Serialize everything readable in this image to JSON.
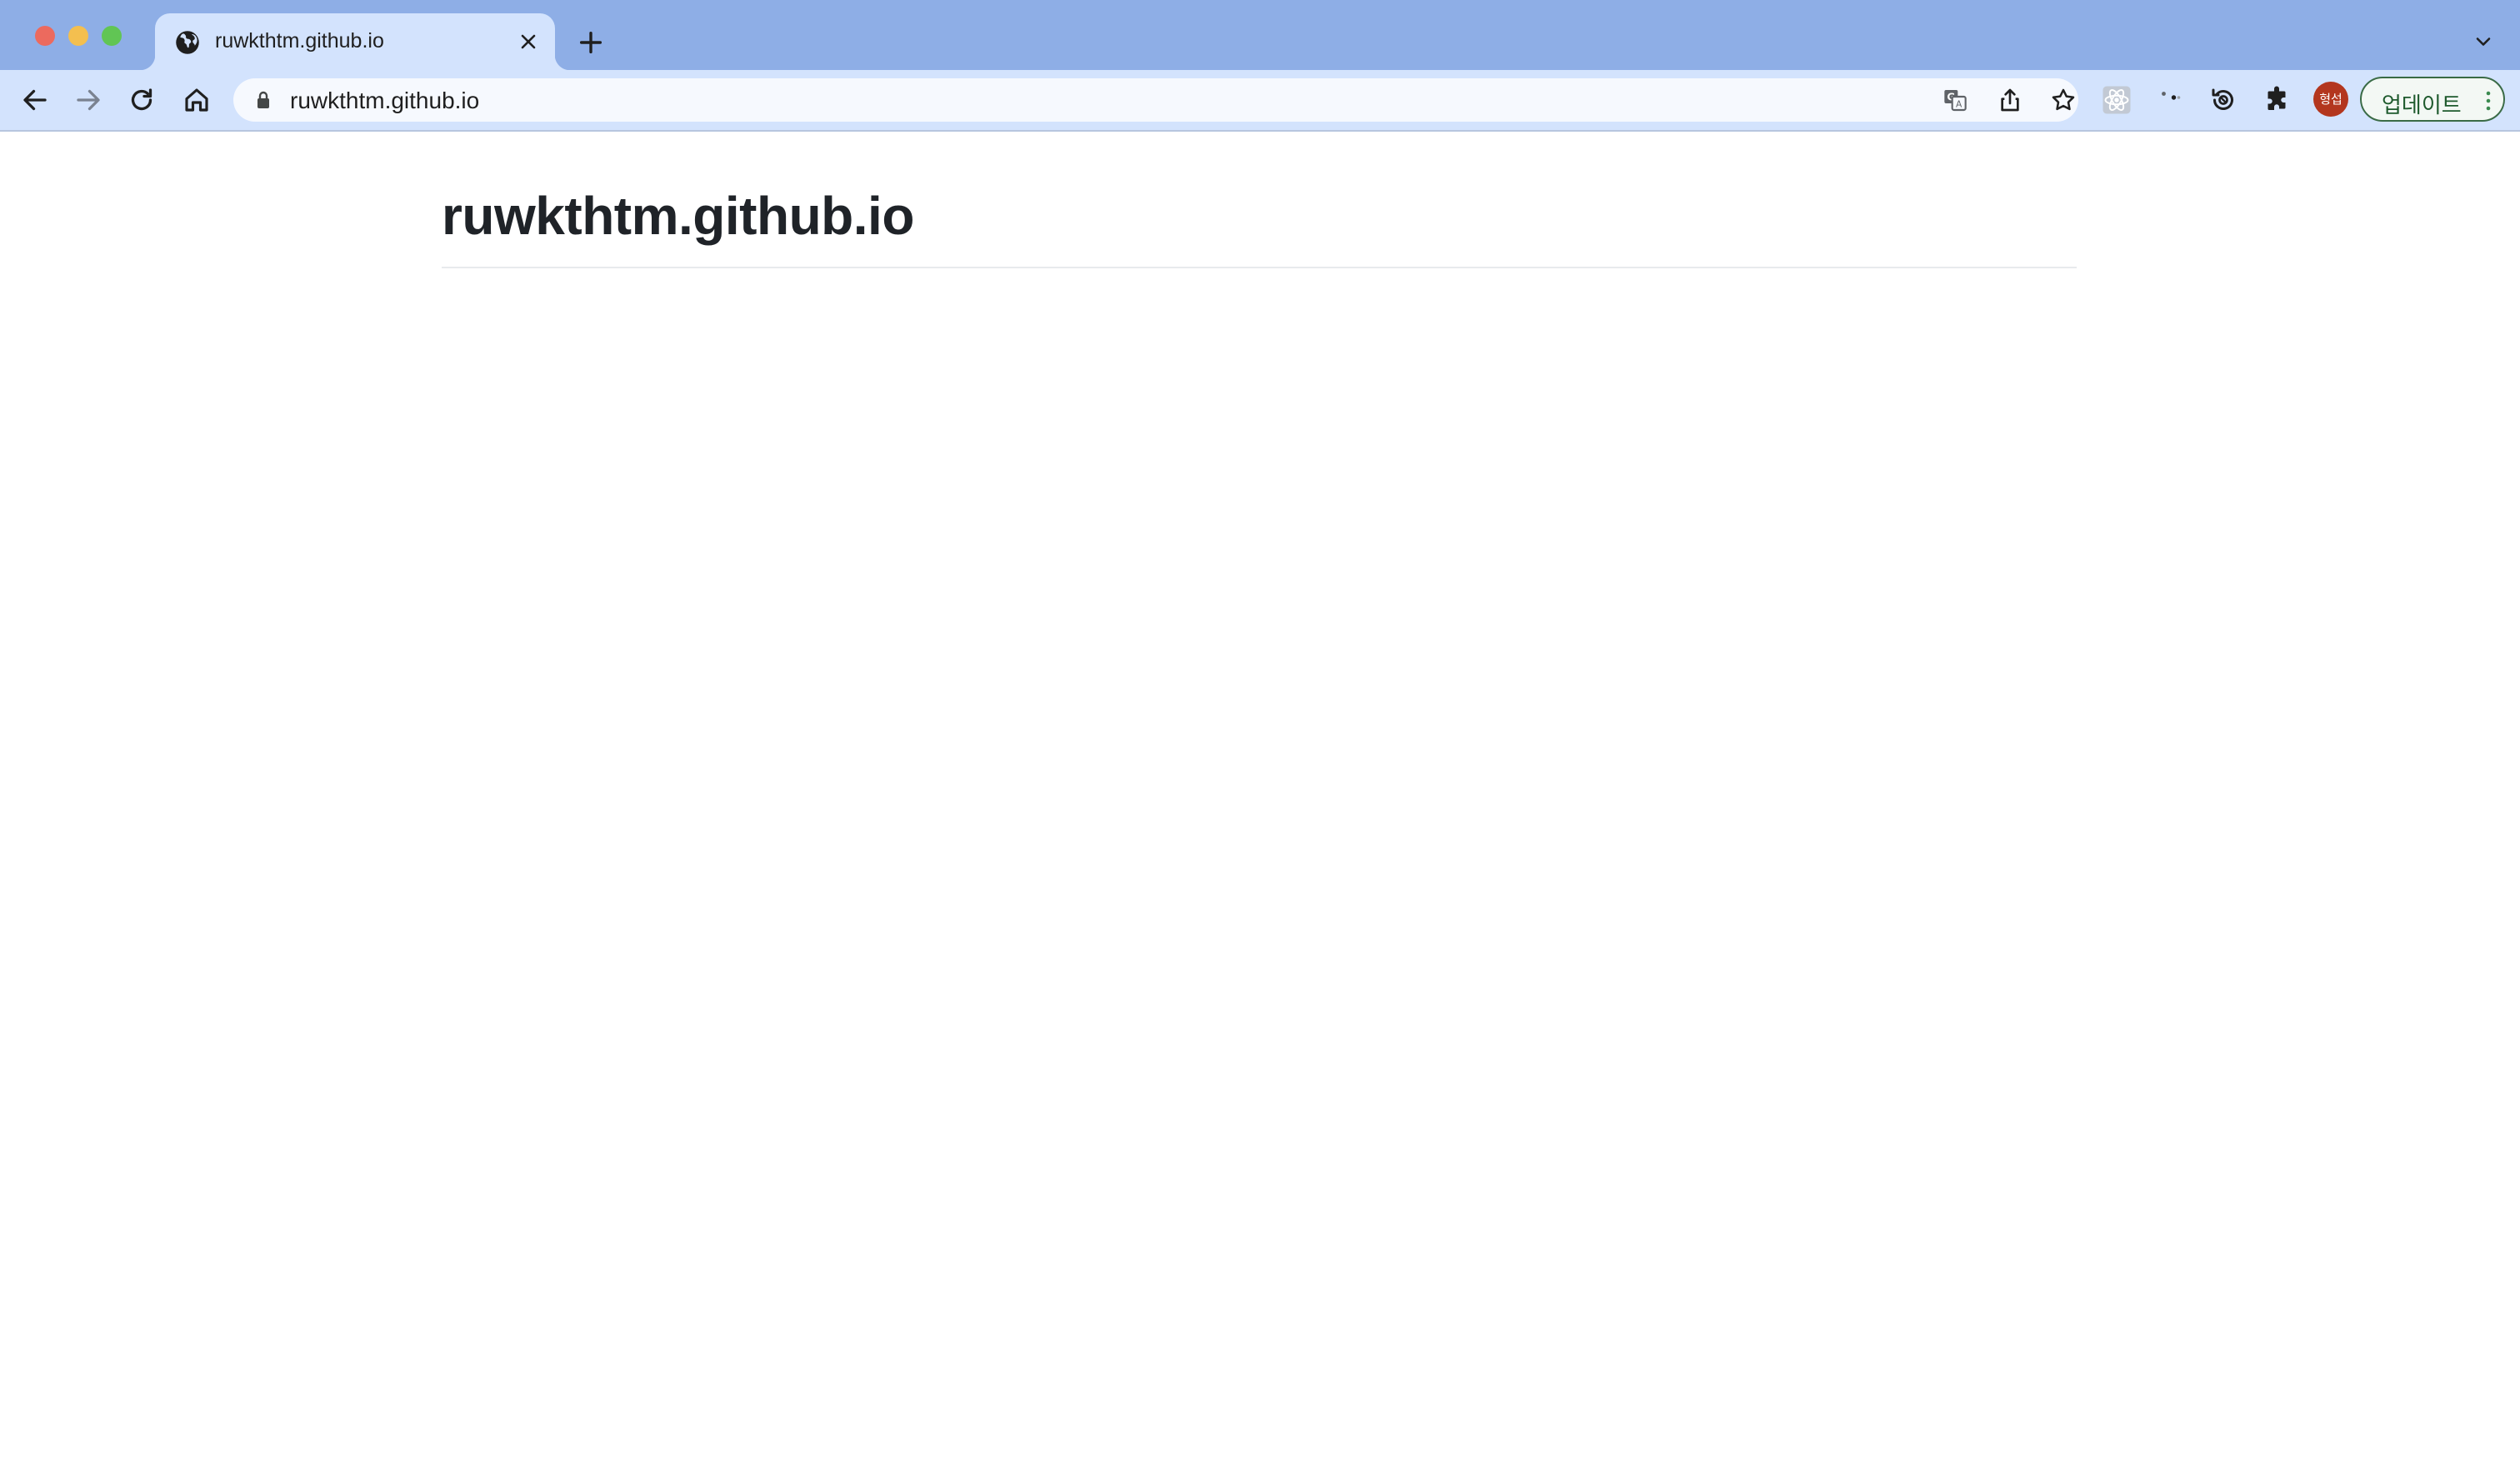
{
  "browser": {
    "tab": {
      "title": "ruwkthtm.github.io",
      "favicon": "globe-icon"
    },
    "omnibox": {
      "url": "ruwkthtm.github.io"
    },
    "avatar_text": "형섭",
    "update_label": "업데이트",
    "colors": {
      "tabstrip": "#8eaee6",
      "active_tab": "#d3e3fd",
      "toolbar": "#d3e3fd",
      "omnibox": "#f6f9fe",
      "avatar": "#b3361e",
      "update_button_text": "#1e5a2d"
    },
    "icons": {
      "window_controls": [
        "close-window-icon",
        "minimize-window-icon",
        "maximize-window-icon"
      ],
      "nav": [
        "back-arrow-icon",
        "forward-arrow-icon",
        "reload-icon",
        "home-icon"
      ],
      "omnibox_actions": [
        "translate-icon",
        "share-icon",
        "bookmark-star-icon"
      ],
      "extensions": [
        "react-devtools-icon",
        "loading-extension-icon",
        "history-extension-icon",
        "puzzle-extensions-icon"
      ]
    }
  },
  "page": {
    "title": "ruwkthtm.github.io"
  }
}
